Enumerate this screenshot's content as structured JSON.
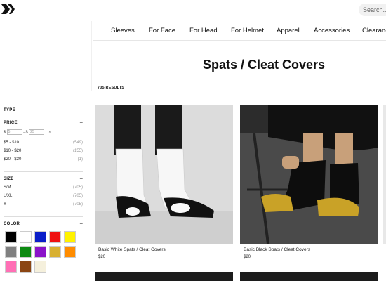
{
  "header": {
    "search_placeholder": "Search..."
  },
  "nav": {
    "items": [
      "Sleeves",
      "For Face",
      "For Head",
      "For Helmet",
      "Apparel",
      "Accessories",
      "Clearance"
    ]
  },
  "page": {
    "title": "Spats / Cleat Covers",
    "results": "705 RESULTS"
  },
  "filters": {
    "type": {
      "label": "TYPE",
      "toggle": "+"
    },
    "price": {
      "label": "PRICE",
      "toggle": "−",
      "currency": "$",
      "min_value": "5",
      "max_value": "25",
      "separator": "- $",
      "go": "»",
      "ranges": [
        {
          "label": "$5 - $10",
          "count": "(549)"
        },
        {
          "label": "$10 - $20",
          "count": "(155)"
        },
        {
          "label": "$20 - $30",
          "count": "(1)"
        }
      ]
    },
    "size": {
      "label": "SIZE",
      "toggle": "−",
      "options": [
        {
          "label": "S/M",
          "count": "(705)"
        },
        {
          "label": "L/XL",
          "count": "(705)"
        },
        {
          "label": "Y",
          "count": "(705)"
        }
      ]
    },
    "color": {
      "label": "COLOR",
      "toggle": "−",
      "swatches": [
        "#000000",
        "#ffffff",
        "#0a1ec8",
        "#ef1111",
        "#fff200",
        "#808080",
        "#0d8a12",
        "#8a12c9",
        "#d8b031",
        "#ff8c00",
        "#ff6fb5",
        "#8b4513",
        "#f5f0dc"
      ]
    }
  },
  "products": [
    {
      "name": "Basic White Spats / Cleat Covers",
      "price": "$20",
      "spat_color": "#ffffff",
      "bg": "#dcdcdc"
    },
    {
      "name": "Basic Black Spats / Cleat Covers",
      "price": "$20",
      "spat_color": "#111111",
      "bg": "#4a4a4a"
    }
  ]
}
